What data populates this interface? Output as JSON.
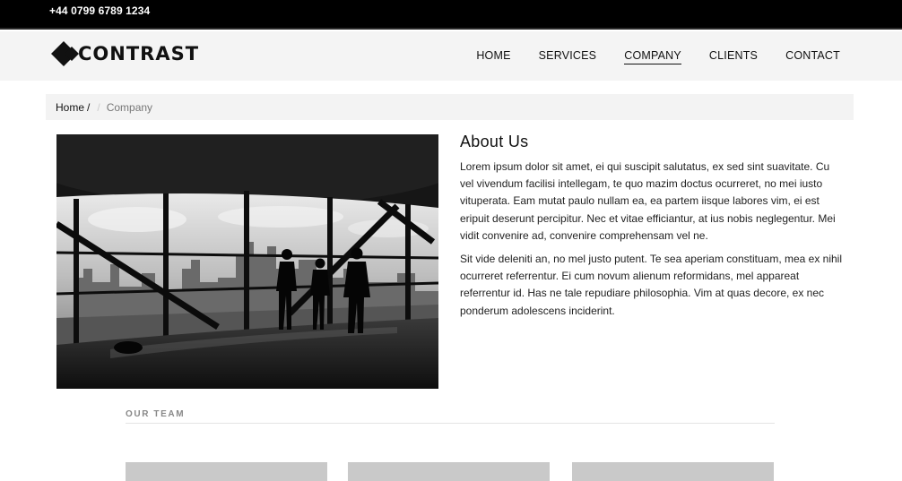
{
  "topbar": {
    "phone": "+44 0799 6789 1234"
  },
  "header": {
    "logo_text": "CONTRAST",
    "nav": [
      {
        "label": "HOME",
        "active": false
      },
      {
        "label": "SERVICES",
        "active": false
      },
      {
        "label": "COMPANY",
        "active": true
      },
      {
        "label": "CLIENTS",
        "active": false
      },
      {
        "label": "CONTACT",
        "active": false
      }
    ]
  },
  "breadcrumb": {
    "home": "Home",
    "separator": "/",
    "current": "Company"
  },
  "about": {
    "title": "About Us",
    "paragraphs": [
      "Lorem ipsum dolor sit amet, ei qui suscipit salutatus, ex sed sint suavitate. Cu vel vivendum facilisi intellegam, te quo mazim doctus ocurreret, no mei iusto vituperata. Eam mutat paulo nullam ea, ea partem iisque labores vim, ei est eripuit deserunt percipitur. Nec et vitae efficiantur, at ius nobis neglegentur. Mei vidit convenire ad, convenire comprehensam vel ne.",
      "Sit vide deleniti an, no mel justo putent. Te sea aperiam constituam, mea ex nihil ocurreret referrentur. Ei cum novum alienum reformidans, mel appareat referrentur id. Has ne tale repudiare philosophia. Vim at quas decore, ex nec ponderum adolescens inciderint."
    ]
  },
  "team": {
    "heading": "OUR TEAM",
    "cards": 3
  },
  "colors": {
    "topbar_bg": "#000000",
    "header_bg": "#f4f4f4",
    "breadcrumb_bg": "#f3f3f3",
    "team_card_placeholder": "#c9c9c9",
    "text": "#222222"
  },
  "icons": {
    "logo": "diamond-logo-icon"
  }
}
